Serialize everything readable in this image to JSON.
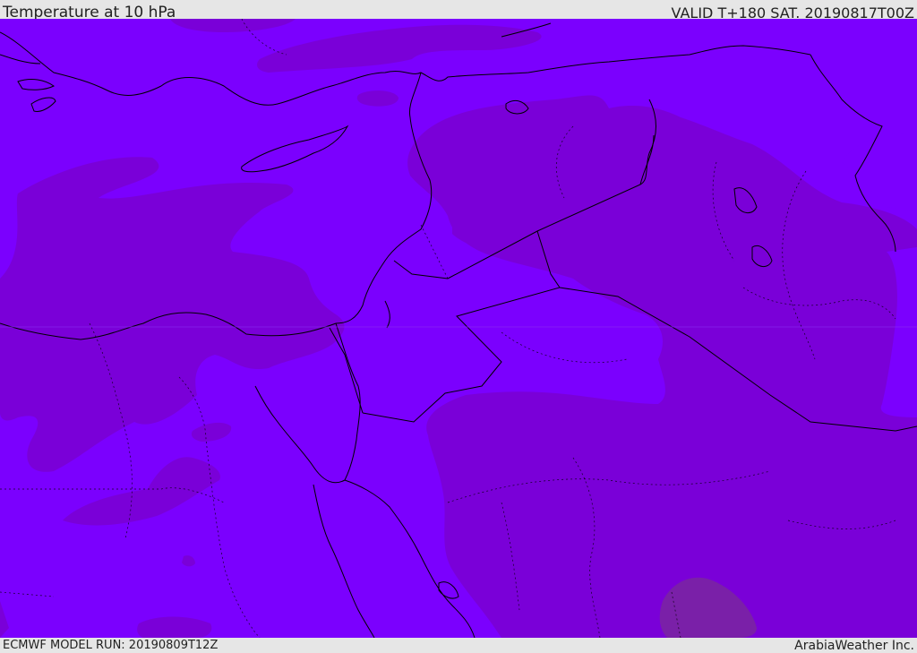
{
  "header": {
    "title": "Temperature at 10 hPa",
    "valid": "VALID T+180 SAT. 20190817T00Z"
  },
  "footer": {
    "model_run": "ECMWF MODEL RUN: 20190809T12Z",
    "credit": "ArabiaWeather Inc."
  },
  "map": {
    "colors": {
      "base_fill": "#7b00fe",
      "band_fill": "#7a00d8",
      "warm_patch": "#7a20a8",
      "border_line": "#000000"
    },
    "layers": [
      "temperature-shading",
      "coastlines",
      "country-borders",
      "province-borders"
    ]
  }
}
